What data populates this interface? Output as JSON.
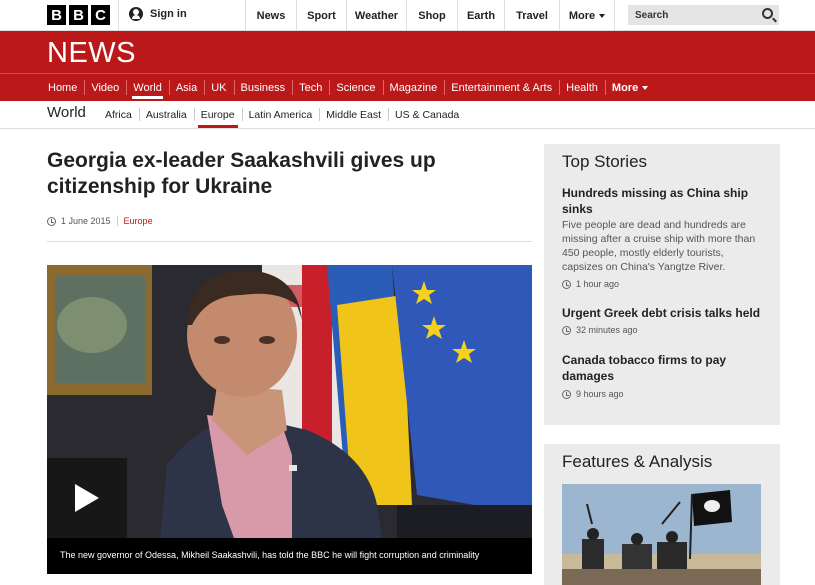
{
  "topbar": {
    "logo": [
      "B",
      "B",
      "C"
    ],
    "signin": "Sign in",
    "nav": [
      "News",
      "Sport",
      "Weather",
      "Shop",
      "Earth",
      "Travel",
      "More"
    ],
    "search_placeholder": "Search"
  },
  "banner": {
    "title": "NEWS"
  },
  "main_nav": [
    "Home",
    "Video",
    "World",
    "Asia",
    "UK",
    "Business",
    "Tech",
    "Science",
    "Magazine",
    "Entertainment & Arts",
    "Health",
    "More"
  ],
  "main_nav_active": "World",
  "subnav": {
    "title": "World",
    "items": [
      "Africa",
      "Australia",
      "Europe",
      "Latin America",
      "Middle East",
      "US & Canada"
    ],
    "active": "Europe"
  },
  "article": {
    "headline": "Georgia ex-leader Saakashvili gives up citizenship for Ukraine",
    "date": "1 June 2015",
    "section": "Europe",
    "video_caption": "The new governor of Odessa, Mikheil Saakashvili, has told the BBC he will fight corruption and criminality"
  },
  "top_stories": {
    "title": "Top Stories",
    "stories": [
      {
        "headline": "Hundreds missing as China ship sinks",
        "summary": "Five people are dead and hundreds are missing after a cruise ship with more than 450 people, mostly elderly tourists, capsizes on China's Yangtze River.",
        "time": "1 hour ago"
      },
      {
        "headline": "Urgent Greek debt crisis talks held",
        "summary": "",
        "time": "32 minutes ago"
      },
      {
        "headline": "Canada tobacco firms to pay damages",
        "summary": "",
        "time": "9 hours ago"
      }
    ]
  },
  "features": {
    "title": "Features & Analysis"
  },
  "colors": {
    "bbc_red": "#bb1919",
    "panel_grey": "#ebebeb"
  }
}
